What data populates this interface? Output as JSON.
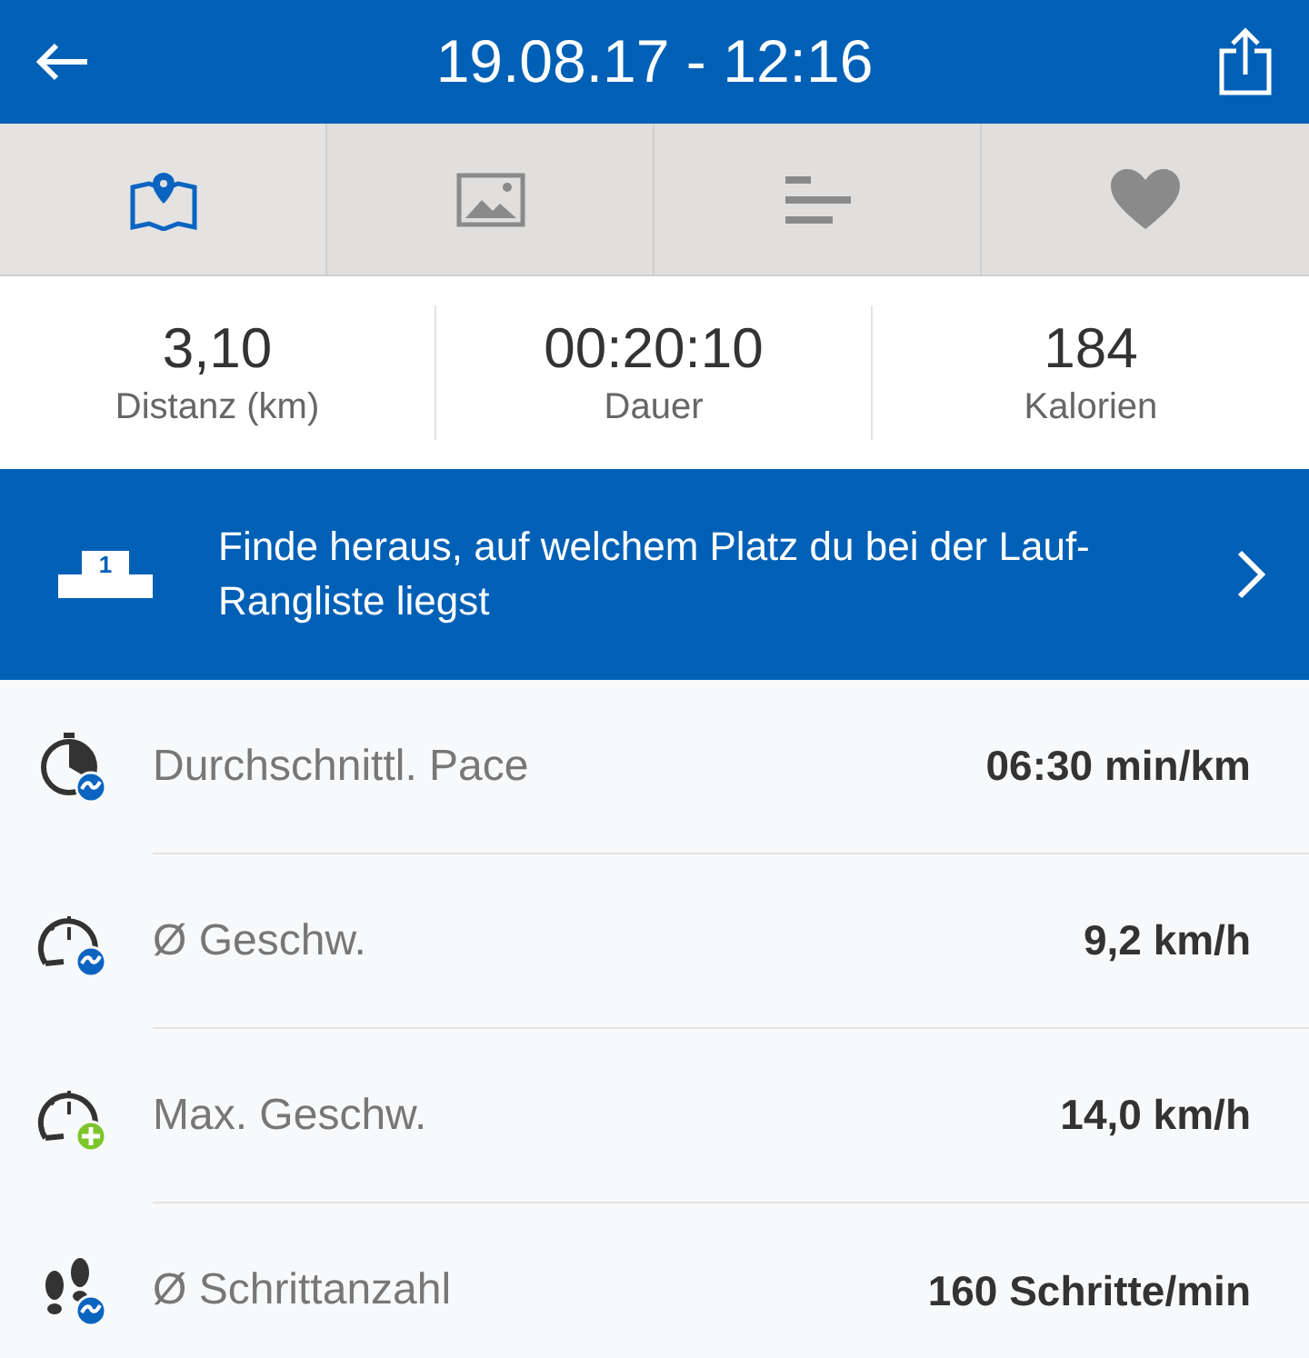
{
  "header": {
    "title": "19.08.17 - 12:16"
  },
  "tabs": [
    {
      "selected": true
    },
    {
      "selected": false
    },
    {
      "selected": false
    },
    {
      "selected": false
    }
  ],
  "stats": [
    {
      "value": "3,10",
      "label": "Distanz (km)"
    },
    {
      "value": "00:20:10",
      "label": "Dauer"
    },
    {
      "value": "184",
      "label": "Kalorien"
    }
  ],
  "banner": {
    "rank": "1",
    "text": "Finde heraus, auf welchem Platz du bei der Lauf-Rangliste liegst"
  },
  "metrics": [
    {
      "kind": "pace",
      "label": "Durchschnittl. Pace",
      "value": "06:30 min/km"
    },
    {
      "kind": "speed",
      "label": "Ø Geschw.",
      "value": "9,2 km/h"
    },
    {
      "kind": "topspeed",
      "label": "Max. Geschw.",
      "value": "14,0 km/h"
    },
    {
      "kind": "cadence",
      "label": "Ø Schrittanzahl",
      "value": "160 Schritte/min"
    }
  ]
}
